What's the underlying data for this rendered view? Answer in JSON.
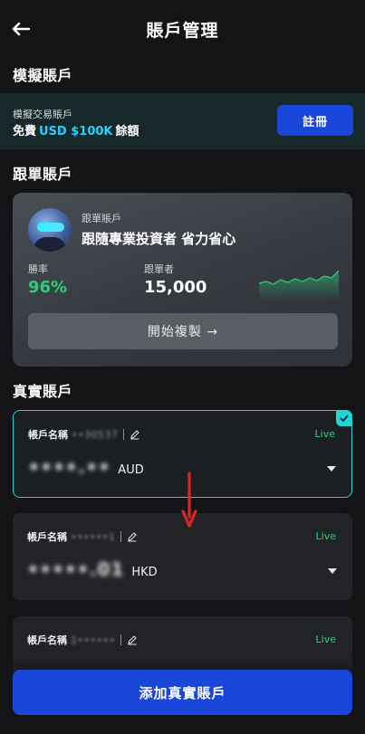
{
  "header": {
    "title": "賬戶管理"
  },
  "demo_section": {
    "title": "模擬賬戶",
    "banner_label": "模擬交易賬戶",
    "offer_free": "免費",
    "offer_amount": "USD $100K",
    "offer_suffix": "餘額",
    "register_label": "註冊"
  },
  "copy_section": {
    "title": "跟單賬戶",
    "card_sub": "跟單賬戶",
    "card_headline": "跟隨專業投資者 省力省心",
    "win_rate_label": "勝率",
    "win_rate_value": "96%",
    "followers_label": "跟單者",
    "followers_value": "15,000",
    "start_copy_label": "開始複製 →"
  },
  "real_section": {
    "title": "真實賬戶",
    "accounts": [
      {
        "name_label": "帳戶名稱",
        "masked_id": "••30537",
        "status": "Live",
        "balance_masked": "••••.••",
        "currency": "AUD",
        "selected": true
      },
      {
        "name_label": "帳戶名稱",
        "masked_id": "••••••1",
        "status": "Live",
        "balance_masked": "•••••.01",
        "currency": "HKD",
        "selected": false
      },
      {
        "name_label": "帳戶名稱",
        "masked_id": "1••••••",
        "status": "Live",
        "balance_masked": "",
        "currency": "",
        "selected": false
      }
    ],
    "add_label": "添加真實賬戶"
  },
  "colors": {
    "accent_blue": "#1a47d9",
    "live_green": "#2ad17a",
    "select_cyan": "#1fd6d6",
    "highlight_blue": "#26d0ff"
  }
}
